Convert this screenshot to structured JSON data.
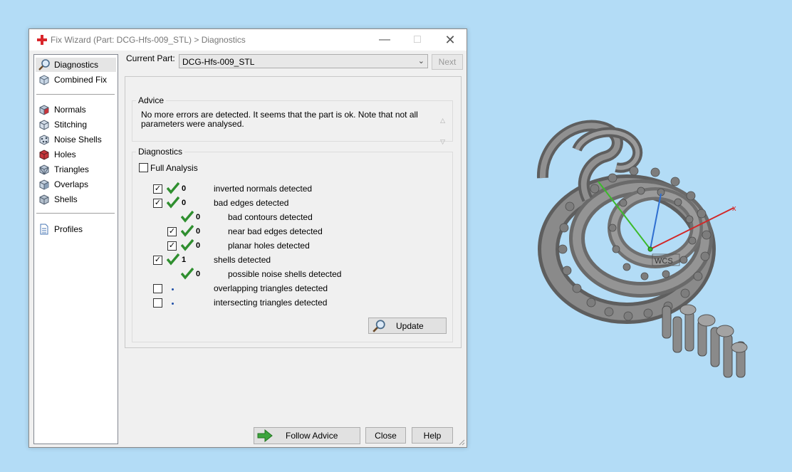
{
  "window": {
    "title": "Fix Wizard (Part: DCG-Hfs-009_STL) > Diagnostics"
  },
  "nav": {
    "items": [
      {
        "label": "Diagnostics",
        "icon": "magnifier-icon"
      },
      {
        "label": "Combined Fix",
        "icon": "combined-fix-icon"
      },
      {
        "label": "Normals",
        "icon": "normals-cube-icon"
      },
      {
        "label": "Stitching",
        "icon": "stitching-cube-icon"
      },
      {
        "label": "Noise Shells",
        "icon": "noise-shells-icon"
      },
      {
        "label": "Holes",
        "icon": "holes-cube-icon"
      },
      {
        "label": "Triangles",
        "icon": "triangles-cube-icon"
      },
      {
        "label": "Overlaps",
        "icon": "overlaps-cube-icon"
      },
      {
        "label": "Shells",
        "icon": "shells-cube-icon"
      },
      {
        "label": "Profiles",
        "icon": "profiles-document-icon"
      }
    ]
  },
  "current_part": {
    "label": "Current Part:",
    "value": "DCG-Hfs-009_STL"
  },
  "buttons": {
    "next": "Next",
    "update": "Update",
    "follow_advice": "Follow Advice",
    "close": "Close",
    "help": "Help"
  },
  "advice": {
    "title": "Advice",
    "text": "No more errors are detected. It seems that the part is ok. Note that not all parameters were analysed."
  },
  "diagnostics": {
    "title": "Diagnostics",
    "full_analysis": "Full Analysis",
    "rows": [
      {
        "count": "0",
        "label": "inverted normals detected"
      },
      {
        "count": "0",
        "label": "bad edges detected"
      },
      {
        "count": "0",
        "label": "bad contours detected"
      },
      {
        "count": "0",
        "label": "near bad edges detected"
      },
      {
        "count": "0",
        "label": "planar holes detected"
      },
      {
        "count": "1",
        "label": "shells detected"
      },
      {
        "count": "0",
        "label": "possible noise shells detected"
      },
      {
        "count": "",
        "label": "overlapping triangles detected"
      },
      {
        "count": "",
        "label": "intersecting triangles detected"
      }
    ]
  },
  "viewport": {
    "axis_x": "x",
    "wcs_label": "WCS"
  },
  "colors": {
    "background": "#b3dcf6",
    "check_green": "#2f8f2f",
    "part_gray": "#7d7d7d"
  }
}
